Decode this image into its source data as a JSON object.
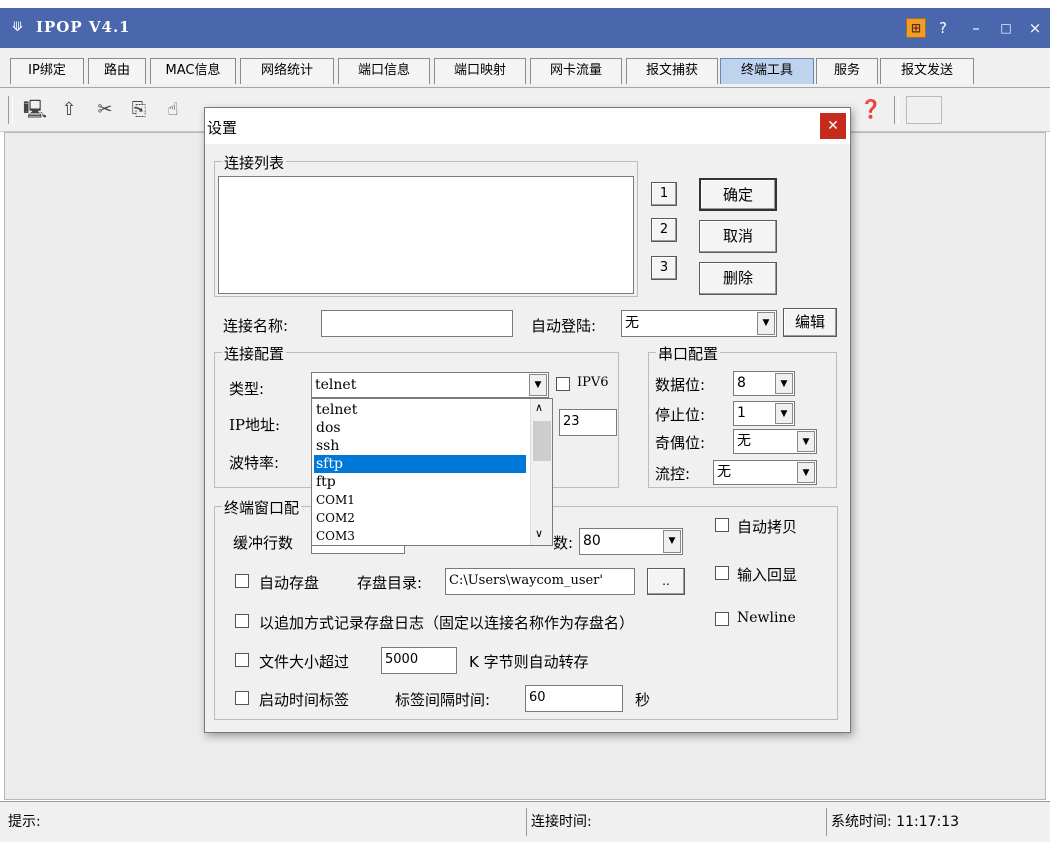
{
  "app": {
    "title": "IPOP V4.1",
    "controls": {
      "help": "?",
      "minimize": "–",
      "maximize": "□",
      "close": "×"
    }
  },
  "tabs": [
    {
      "label": "IP绑定"
    },
    {
      "label": "路由"
    },
    {
      "label": "MAC信息"
    },
    {
      "label": "网络统计"
    },
    {
      "label": "端口信息"
    },
    {
      "label": "端口映射"
    },
    {
      "label": "网卡流量"
    },
    {
      "label": "报文捕获"
    },
    {
      "label": "终端工具",
      "active": true
    },
    {
      "label": "服务"
    },
    {
      "label": "报文发送"
    }
  ],
  "dialog": {
    "title": "设置",
    "conn_list_legend": "连接列表",
    "num_buttons": [
      "1",
      "2",
      "3"
    ],
    "ok": "确定",
    "cancel": "取消",
    "delete": "删除",
    "conn_name_label": "连接名称:",
    "conn_name_value": "",
    "auto_login_label": "自动登陆:",
    "auto_login_value": "无",
    "edit": "编辑",
    "conn_cfg_legend": "连接配置",
    "type_label": "类型:",
    "type_value": "telnet",
    "ipv6_label": "IPV6",
    "ip_label": "IP地址:",
    "port_value": "23",
    "baud_label": "波特率:",
    "dropdown_items": [
      "telnet",
      "dos",
      "ssh",
      "sftp",
      "ftp",
      "COM1",
      "COM2",
      "COM3"
    ],
    "dropdown_selected": "sftp",
    "serial_legend": "串口配置",
    "data_bits_label": "数据位:",
    "data_bits_value": "8",
    "stop_bits_label": "停止位:",
    "stop_bits_value": "1",
    "parity_label": "奇偶位:",
    "parity_value": "无",
    "flow_label": "流控:",
    "flow_value": "无",
    "term_legend": "终端窗口配",
    "buffer_label": "缓冲行数",
    "cols_label": "数:",
    "cols_value": "80",
    "auto_copy": "自动拷贝",
    "echo": "输入回显",
    "auto_save": "自动存盘",
    "save_dir_label": "存盘目录:",
    "save_dir_value": "C:\\Users\\waycom_user'",
    "browse": "..",
    "append_log": "以追加方式记录存盘日志（固定以连接名称作为存盘名）",
    "newline": "Newline",
    "file_size_label": "文件大小超过",
    "file_size_value": "5000",
    "file_size_suffix": "K 字节则自动转存",
    "timestamp_label": "启动时间标签",
    "interval_label": "标签间隔时间:",
    "interval_value": "60",
    "interval_unit": "秒"
  },
  "status": {
    "hint": "提示:",
    "conn_time": "连接时间:",
    "sys_time_label": "系统时间:",
    "sys_time": "11:17:13"
  }
}
